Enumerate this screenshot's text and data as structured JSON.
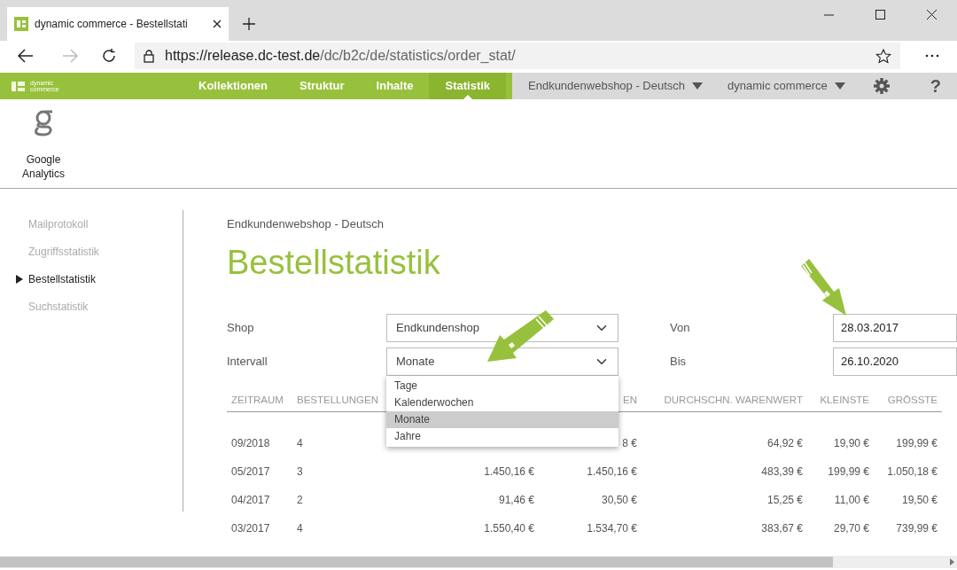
{
  "browser": {
    "tab_title": "dynamic commerce - Bestellstati",
    "url_host": "https://release.dc-test.de",
    "url_path": "/dc/b2c/de/statistics/order_stat/"
  },
  "nav": {
    "logo_text": "dynamic commerce",
    "items": [
      {
        "label": "Kollektionen",
        "selected": false
      },
      {
        "label": "Struktur",
        "selected": false
      },
      {
        "label": "Inhalte",
        "selected": false
      },
      {
        "label": "Statistik",
        "selected": true
      }
    ],
    "dropdowns": [
      "Endkundenwebshop - Deutsch",
      "dynamic commerce"
    ],
    "help": "?"
  },
  "apps": [
    {
      "label": "Google Analytics"
    }
  ],
  "sidebar": {
    "items": [
      {
        "label": "Mailprotokoll",
        "selected": false
      },
      {
        "label": "Zugriffsstatistik",
        "selected": false
      },
      {
        "label": "Bestellstatistik",
        "selected": true
      },
      {
        "label": "Suchstatistik",
        "selected": false
      }
    ]
  },
  "breadcrumb": "Endkundenwebshop - Deutsch",
  "title": "Bestellstatistik",
  "form": {
    "shop_label": "Shop",
    "shop_value": "Endkundenshop",
    "interval_label": "Intervall",
    "interval_value": "Monate",
    "from_label": "Von",
    "from_value": "28.03.2017",
    "to_label": "Bis",
    "to_value": "26.10.2020"
  },
  "interval_options": [
    {
      "label": "Tage",
      "selected": false
    },
    {
      "label": "Kalenderwochen",
      "selected": false
    },
    {
      "label": "Monate",
      "selected": true
    },
    {
      "label": "Jahre",
      "selected": false
    }
  ],
  "table": {
    "columns": [
      "ZEITRAUM",
      "BESTELLUNGEN",
      null,
      "EN",
      "DURCHSCHN. WARENWERT",
      "KLEINSTE",
      "GRÖSSTE"
    ],
    "rows": [
      [
        "09/2018",
        "4",
        null,
        "8 €",
        "64,92 €",
        "19,90 €",
        "199,99 €"
      ],
      [
        "05/2017",
        "3",
        "1.450,16 €",
        "1.450,16 €",
        "483,39 €",
        "199,99 €",
        "1.050,18 €"
      ],
      [
        "04/2017",
        "2",
        "91,46 €",
        "30,50 €",
        "15,25 €",
        "11,00 €",
        "19,50 €"
      ],
      [
        "03/2017",
        "4",
        "1.550,40 €",
        "1.534,70 €",
        "383,67 €",
        "29,70 €",
        "739,99 €"
      ]
    ]
  }
}
